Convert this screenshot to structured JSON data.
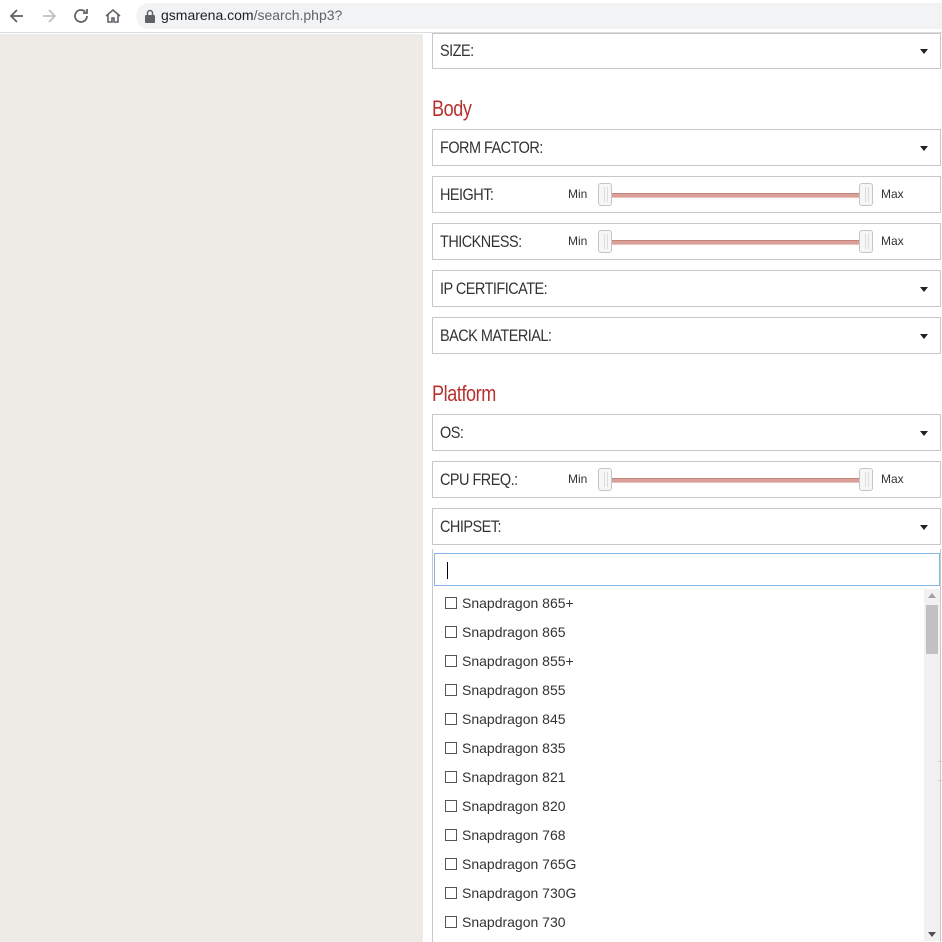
{
  "browser": {
    "url_host": "gsmarena.com",
    "url_path": "/search.php3?"
  },
  "fields": {
    "size": "SIZE:",
    "form_factor": "FORM FACTOR:",
    "height": "HEIGHT:",
    "thickness": "THICKNESS:",
    "ip_certificate": "IP CERTIFICATE:",
    "back_material": "BACK MATERIAL:",
    "os": "OS:",
    "cpu_freq": "CPU FREQ.:",
    "chipset": "CHIPSET:"
  },
  "sections": {
    "body": "Body",
    "platform": "Platform"
  },
  "slider": {
    "min": "Min",
    "max": "Max"
  },
  "chipset_search": {
    "value": ""
  },
  "chipset_options": [
    "Snapdragon 865+",
    "Snapdragon 865",
    "Snapdragon 855+",
    "Snapdragon 855",
    "Snapdragon 845",
    "Snapdragon 835",
    "Snapdragon 821",
    "Snapdragon 820",
    "Snapdragon 768",
    "Snapdragon 765G",
    "Snapdragon 730G",
    "Snapdragon 730"
  ]
}
